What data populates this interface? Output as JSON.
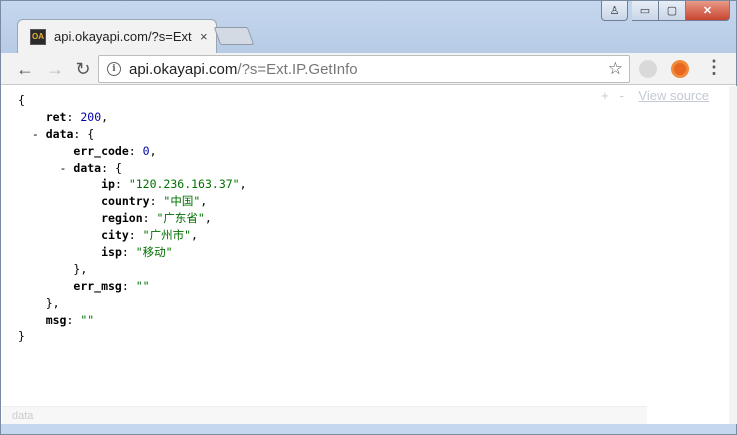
{
  "browser": {
    "tab_title": "api.okayapi.com/?s=Ext",
    "tab_close": "×",
    "favicon_text": "OA",
    "url_host": "api.okayapi.com",
    "url_rest": "/?s=Ext.IP.GetInfo",
    "nav": {
      "back": "←",
      "forward": "→",
      "reload": "↻"
    },
    "star": "☆",
    "menu": "⋮",
    "window_controls": {
      "user": "♙",
      "minimize": "▭",
      "maximize": "▢",
      "close": "✕"
    }
  },
  "viewer": {
    "expand_all": "+",
    "collapse_all": "-",
    "view_source": "View source"
  },
  "json": {
    "lines": [
      {
        "indent": 0,
        "toggle": "",
        "key": "",
        "value": "{",
        "type": "punct"
      },
      {
        "indent": 1,
        "toggle": "",
        "key": "ret",
        "value": "200",
        "type": "num",
        "trail": ","
      },
      {
        "indent": 1,
        "toggle": "- ",
        "key": "data",
        "value": "{",
        "type": "punct"
      },
      {
        "indent": 2,
        "toggle": "",
        "key": "err_code",
        "value": "0",
        "type": "num",
        "trail": ","
      },
      {
        "indent": 2,
        "toggle": "- ",
        "key": "data",
        "value": "{",
        "type": "punct"
      },
      {
        "indent": 3,
        "toggle": "",
        "key": "ip",
        "value": "\"120.236.163.37\"",
        "type": "str",
        "trail": ","
      },
      {
        "indent": 3,
        "toggle": "",
        "key": "country",
        "value": "\"中国\"",
        "type": "str",
        "trail": ","
      },
      {
        "indent": 3,
        "toggle": "",
        "key": "region",
        "value": "\"广东省\"",
        "type": "str",
        "trail": ","
      },
      {
        "indent": 3,
        "toggle": "",
        "key": "city",
        "value": "\"广州市\"",
        "type": "str",
        "trail": ","
      },
      {
        "indent": 3,
        "toggle": "",
        "key": "isp",
        "value": "\"移动\"",
        "type": "str",
        "trail": ""
      },
      {
        "indent": 2,
        "toggle": "",
        "key": "",
        "value": "},",
        "type": "punct"
      },
      {
        "indent": 2,
        "toggle": "",
        "key": "err_msg",
        "value": "\"\"",
        "type": "str",
        "trail": ""
      },
      {
        "indent": 1,
        "toggle": "",
        "key": "",
        "value": "},",
        "type": "punct"
      },
      {
        "indent": 1,
        "toggle": "",
        "key": "msg",
        "value": "\"\"",
        "type": "str",
        "trail": ""
      },
      {
        "indent": 0,
        "toggle": "",
        "key": "",
        "value": "}",
        "type": "punct"
      }
    ]
  },
  "status": {
    "text": "data"
  }
}
